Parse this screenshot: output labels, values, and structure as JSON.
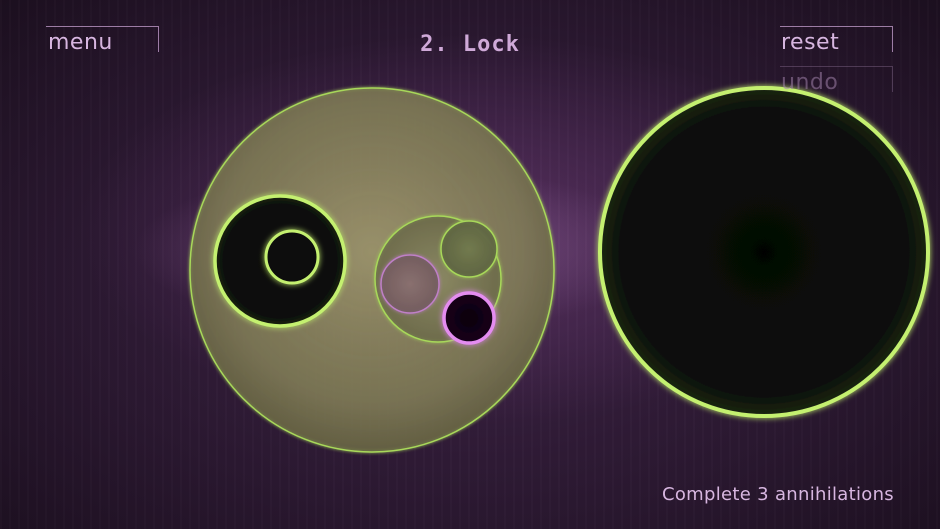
{
  "header": {
    "menu_label": "menu",
    "level_title": "2. Lock",
    "reset_label": "reset",
    "undo_label": "undo"
  },
  "footer": {
    "objective": "Complete 3 annihilations"
  },
  "colors": {
    "green_glow": "#b8f060",
    "magenta_glow": "#e080f0",
    "text": "#d7b6e0"
  }
}
